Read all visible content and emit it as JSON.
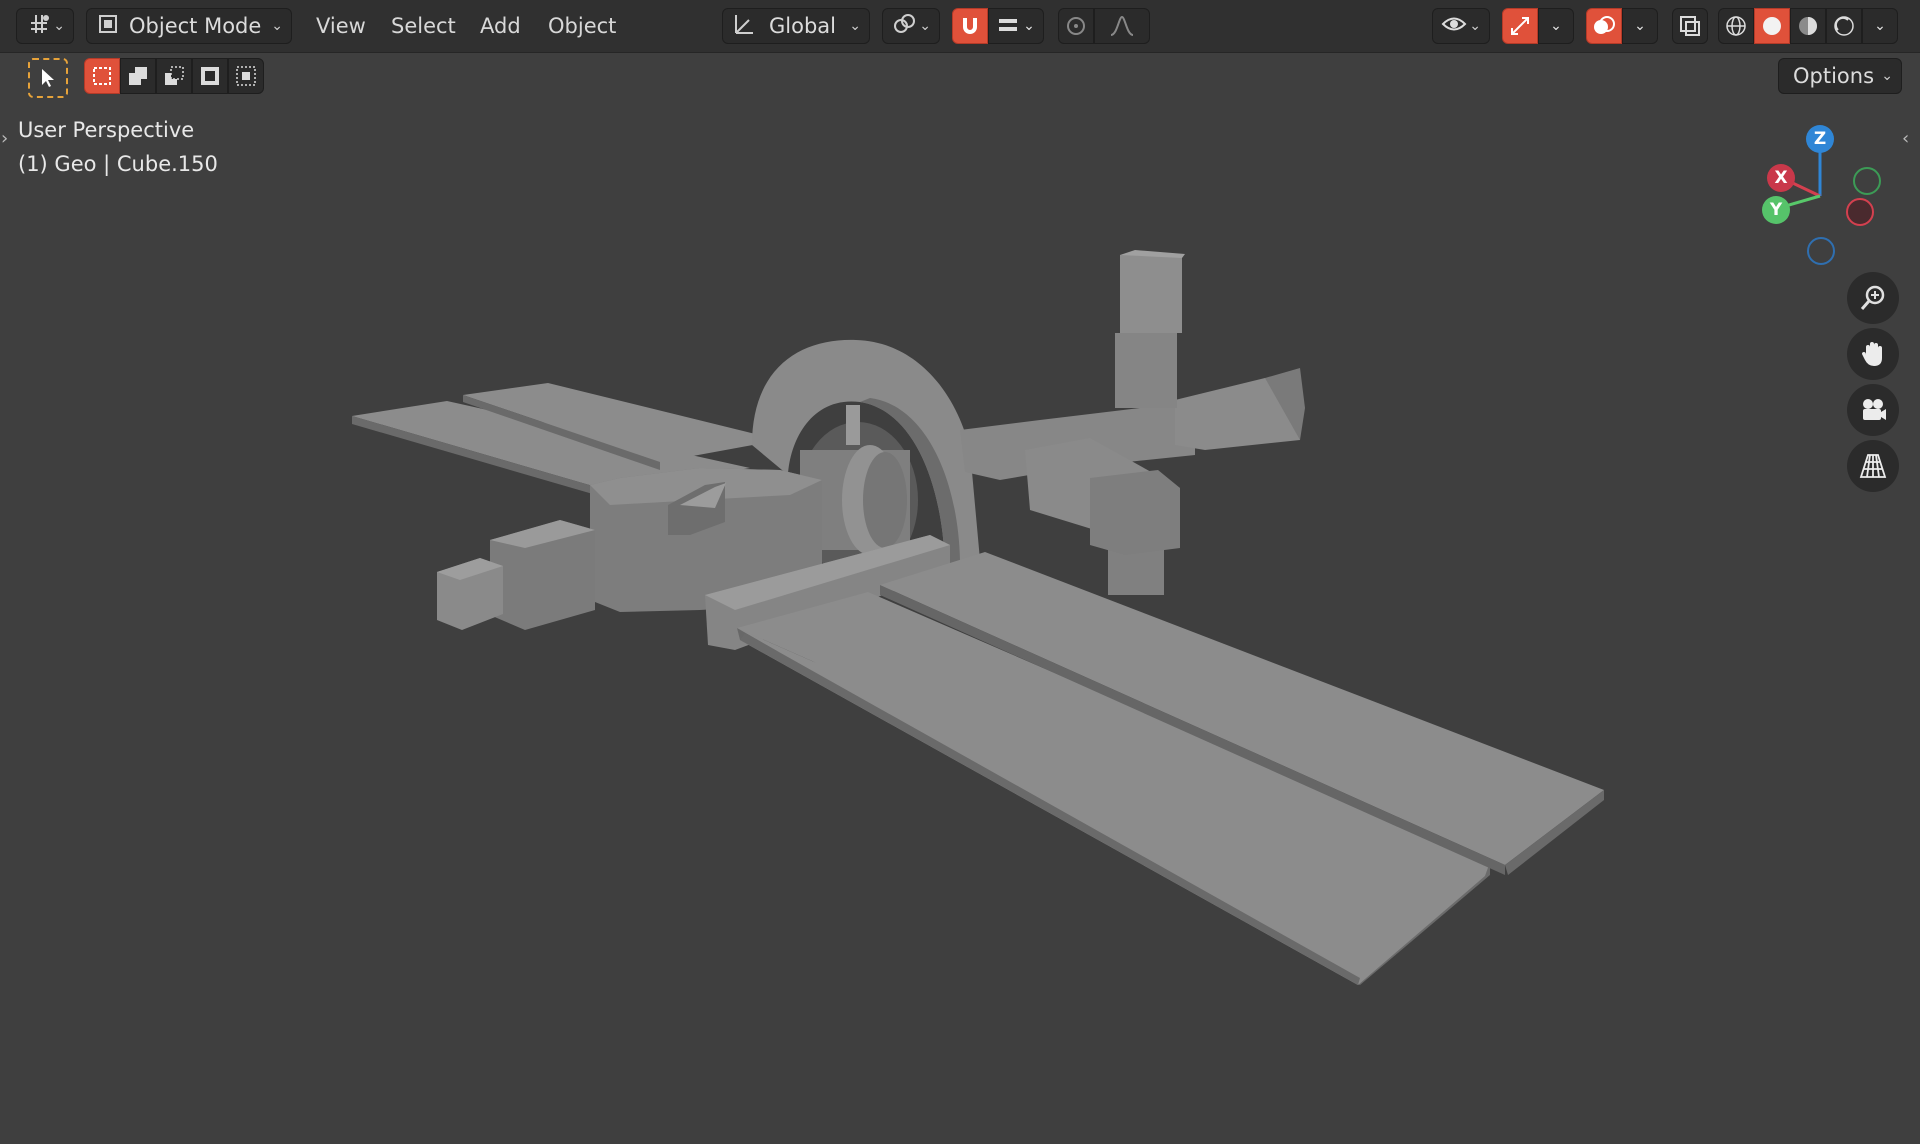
{
  "header": {
    "editor_type_icon": "editor-type-icon",
    "mode_label": "Object Mode",
    "menu": [
      "View",
      "Select",
      "Add",
      "Object"
    ],
    "transform_orientation_label": "Global",
    "options_label": "Options"
  },
  "viewport": {
    "perspective_label": "User Perspective",
    "object_info": "(1) Geo | Cube.150"
  },
  "gizmo": {
    "z_label": "Z",
    "x_label": "X",
    "y_label": "Y"
  },
  "colors": {
    "accent_red": "#e0513a",
    "axis_x": "#d4404f",
    "axis_y": "#58c86a",
    "axis_z": "#2f86d6",
    "model_gray": "#8c8c8c"
  }
}
